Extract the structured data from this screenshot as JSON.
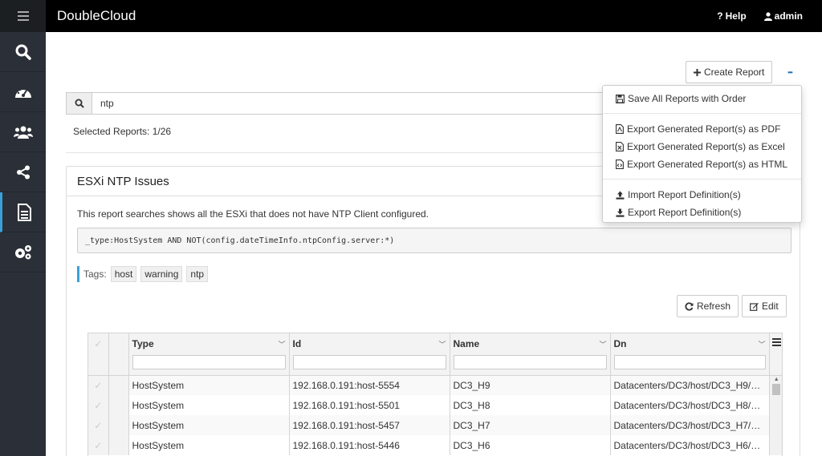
{
  "header": {
    "brand": "DoubleCloud",
    "help_label": "Help",
    "admin_label": "admin"
  },
  "sidebar": {
    "items": [
      {
        "icon": "search-icon"
      },
      {
        "icon": "dashboard-icon"
      },
      {
        "icon": "users-icon"
      },
      {
        "icon": "share-icon"
      },
      {
        "icon": "report-icon",
        "active": true
      },
      {
        "icon": "settings-icon"
      }
    ],
    "accent": "#3aa0d8"
  },
  "toolbar": {
    "create_report": "Create Report",
    "more": "•••"
  },
  "search": {
    "value": "ntp"
  },
  "selected_text": "Selected Reports: 1/26",
  "report": {
    "title": "ESXi NTP Issues",
    "description": "This report searches shows all the ESXi that does not have NTP Client configured.",
    "query": "_type:HostSystem AND NOT(config.dateTimeInfo.ntpConfig.server:*)",
    "tags_label": "Tags:",
    "tags": [
      "host",
      "warning",
      "ntp"
    ],
    "refresh_label": "Refresh",
    "edit_label": "Edit"
  },
  "grid": {
    "columns": [
      "Type",
      "Id",
      "Name",
      "Dn"
    ],
    "rows": [
      [
        "HostSystem",
        "192.168.0.191:host-5554",
        "DC3_H9",
        "Datacenters/DC3/host/DC3_H9/D…"
      ],
      [
        "HostSystem",
        "192.168.0.191:host-5501",
        "DC3_H8",
        "Datacenters/DC3/host/DC3_H8/D…"
      ],
      [
        "HostSystem",
        "192.168.0.191:host-5457",
        "DC3_H7",
        "Datacenters/DC3/host/DC3_H7/D…"
      ],
      [
        "HostSystem",
        "192.168.0.191:host-5446",
        "DC3_H6",
        "Datacenters/DC3/host/DC3_H6/D…"
      ]
    ]
  },
  "dropdown": {
    "save_all": "Save All Reports with Order",
    "export_pdf": "Export Generated Report(s) as PDF",
    "export_excel": "Export Generated Report(s) as Excel",
    "export_html": "Export Generated Report(s) as HTML",
    "import_def": "Import Report Definition(s)",
    "export_def": "Export Report Definition(s)"
  }
}
